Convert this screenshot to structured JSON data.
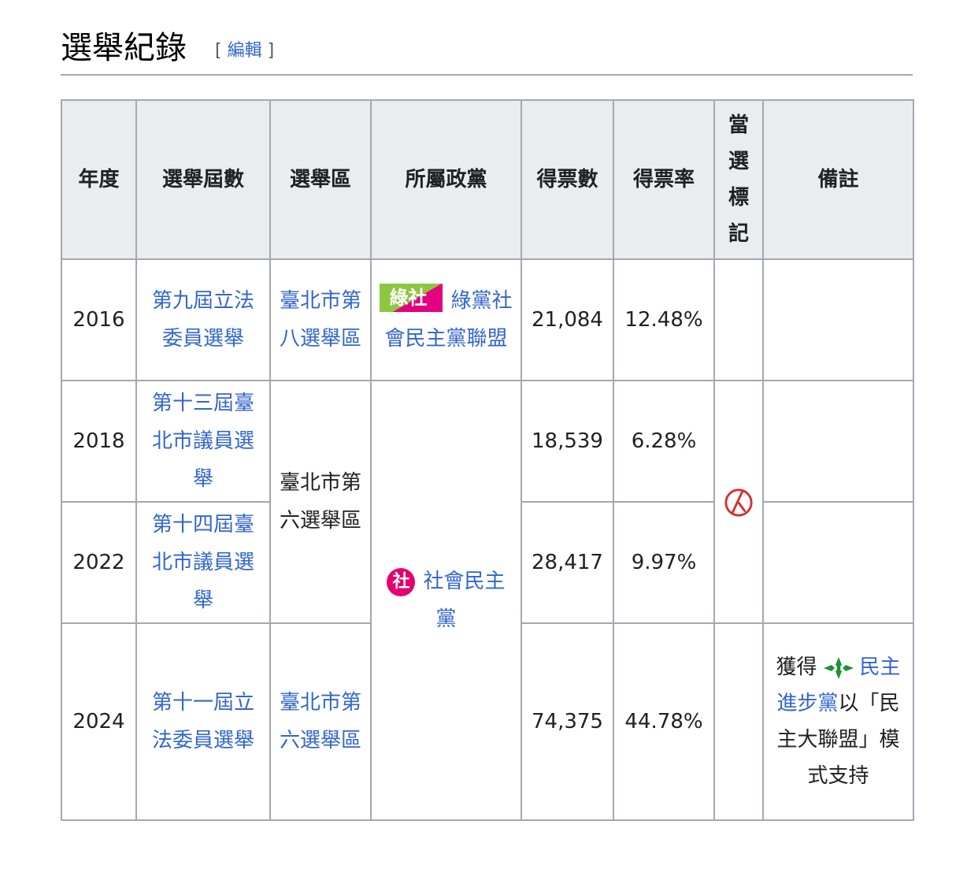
{
  "section": {
    "title": "選舉紀錄",
    "edit_open": "[",
    "edit_label": "編輯",
    "edit_close": "]"
  },
  "table": {
    "headers": [
      "年度",
      "選舉屆數",
      "選舉區",
      "所屬政黨",
      "得票數",
      "得票率",
      "當選標記",
      "備註"
    ],
    "rows": [
      {
        "year": "2016",
        "election": "第九屆立法委員選舉",
        "district": "臺北市第八選舉區",
        "votes": "21,084",
        "rate": "12.48%"
      },
      {
        "year": "2018",
        "election": "第十三屆臺北市議員選舉",
        "votes": "18,539",
        "rate": "6.28%"
      },
      {
        "year": "2022",
        "election": "第十四屆臺北市議員選舉",
        "votes": "28,417",
        "rate": "9.97%"
      },
      {
        "year": "2024",
        "election": "第十一屆立法委員選舉",
        "district": "臺北市第六選舉區",
        "votes": "74,375",
        "rate": "44.78%"
      }
    ],
    "district_shared": "臺北市第六選舉區",
    "party_green_badge": "綠社",
    "party_green": "綠黨社會民主黨聯盟",
    "party_sdp_badge": "社",
    "party_sdp": "社會民主黨",
    "remark_prefix": "獲得",
    "remark_party": "民主進步黨",
    "remark_suffix": "以「民主大聯盟」模式支持"
  },
  "colors": {
    "link": "#3366cc",
    "header_bg": "#eaecf0",
    "border": "#a2a9b1",
    "sdp_pink": "#e0348c",
    "green_party": "#8dc63f",
    "elected_mark": "#d32f2f",
    "dpp_green": "#1b9431"
  },
  "icons": {
    "elected": "elected-stamp-icon",
    "green_party": "green-social-democratic-alliance-logo",
    "sdp": "social-democratic-party-logo",
    "dpp": "dpp-logo-icon"
  }
}
